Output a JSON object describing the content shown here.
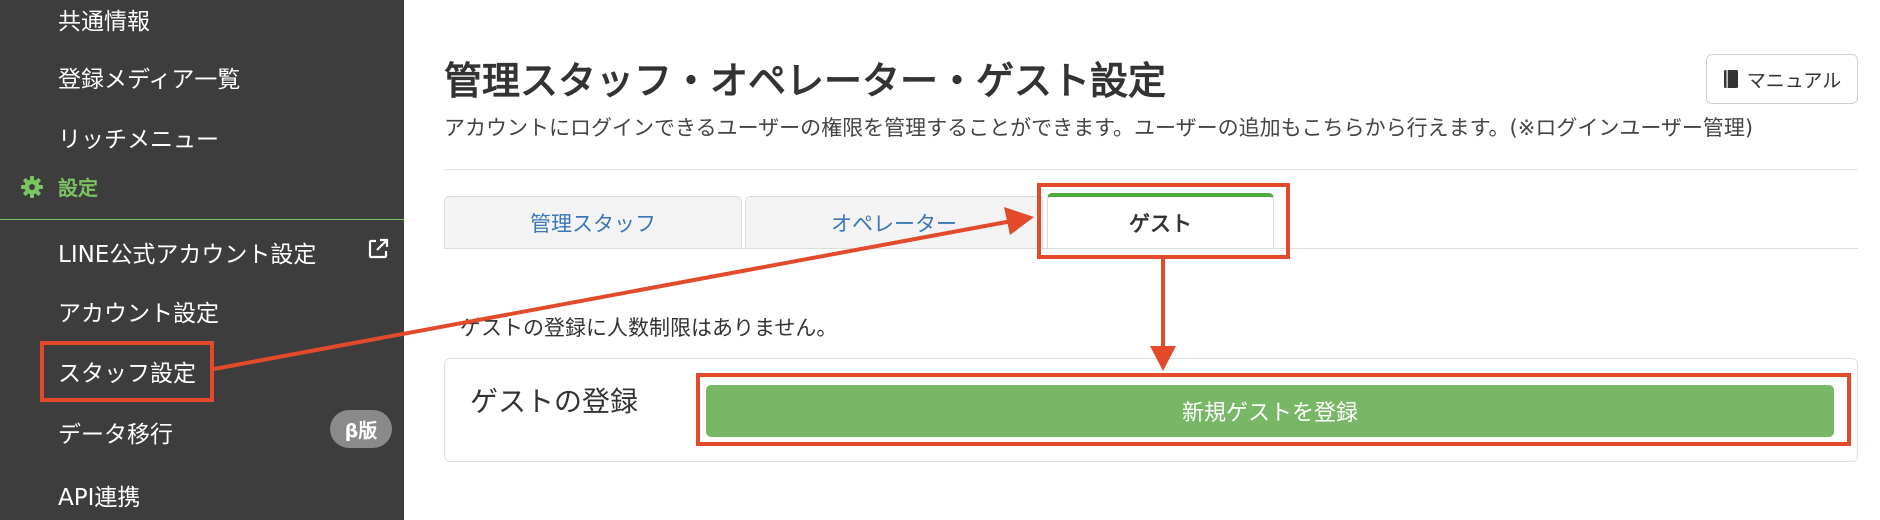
{
  "sidebar": {
    "items": [
      {
        "label": "共通情報"
      },
      {
        "label": "登録メディア一覧"
      },
      {
        "label": "リッチメニュー"
      },
      {
        "label": "LINE公式アカウント設定"
      },
      {
        "label": "アカウント設定"
      },
      {
        "label": "スタッフ設定"
      },
      {
        "label": "データ移行"
      },
      {
        "label": "API連携"
      }
    ],
    "section_label": "設定",
    "section_icon": "gear-icon",
    "beta_badge": "β版",
    "accent_color": "#7ac463"
  },
  "header": {
    "title": "管理スタッフ・オペレーター・ゲスト設定",
    "description": "アカウントにログインできるユーザーの権限を管理することができます。ユーザーの追加もこちらから行えます。(※ログインユーザー管理)",
    "manual_label": "マニュアル"
  },
  "tabs": [
    {
      "label": "管理スタッフ",
      "active": false
    },
    {
      "label": "オペレーター",
      "active": false
    },
    {
      "label": "ゲスト",
      "active": true
    }
  ],
  "guest": {
    "limit_note": "ゲストの登録に人数制限はありません。",
    "section_label": "ゲストの登録",
    "register_button": "新規ゲストを登録",
    "button_color": "#78b765"
  },
  "annotation_color": "#e24a2b"
}
